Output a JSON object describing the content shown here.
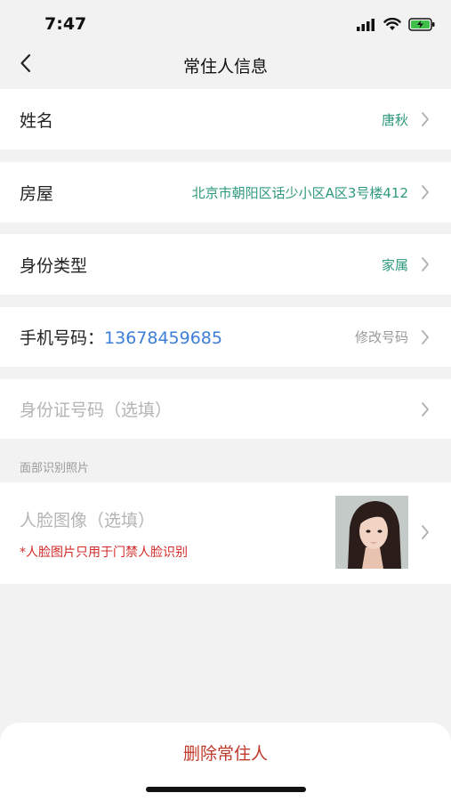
{
  "status": {
    "time": "7:47"
  },
  "nav": {
    "title": "常住人信息"
  },
  "rows": {
    "name": {
      "label": "姓名",
      "value": "唐秋"
    },
    "house": {
      "label": "房屋",
      "value": "北京市朝阳区话少小区A区3号楼412"
    },
    "identity": {
      "label": "身份类型",
      "value": "家属"
    },
    "phone": {
      "label": "手机号码：",
      "number": "13678459685",
      "action": "修改号码"
    },
    "id_card": {
      "placeholder": "身份证号码（选填）"
    }
  },
  "face_section": {
    "caption": "面部识别照片",
    "label": "人脸图像（选填）",
    "note": "*人脸图片只用于门禁人脸识别"
  },
  "bottom": {
    "delete_label": "删除常住人"
  },
  "colors": {
    "accent_green": "#2e9a7c",
    "link_blue": "#3d7ed8",
    "danger_red": "#c0392b"
  }
}
